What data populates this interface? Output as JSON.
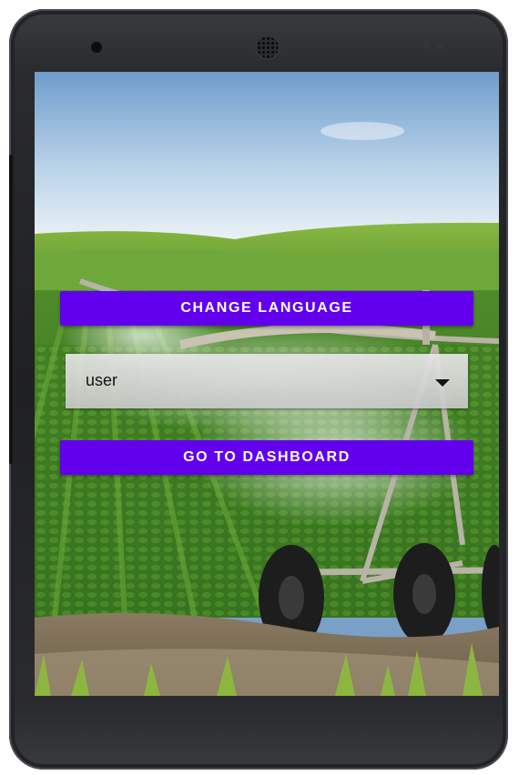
{
  "buttons": {
    "change_language": "CHANGE LANGUAGE",
    "go_to_dashboard": "GO TO DASHBOARD"
  },
  "spinner": {
    "selected_value": "user",
    "icon": "dropdown-arrow-icon"
  },
  "colors": {
    "accent": "#6200ee",
    "button_text": "#ffffff"
  },
  "background": {
    "subject": "farm field with center-pivot irrigation"
  }
}
